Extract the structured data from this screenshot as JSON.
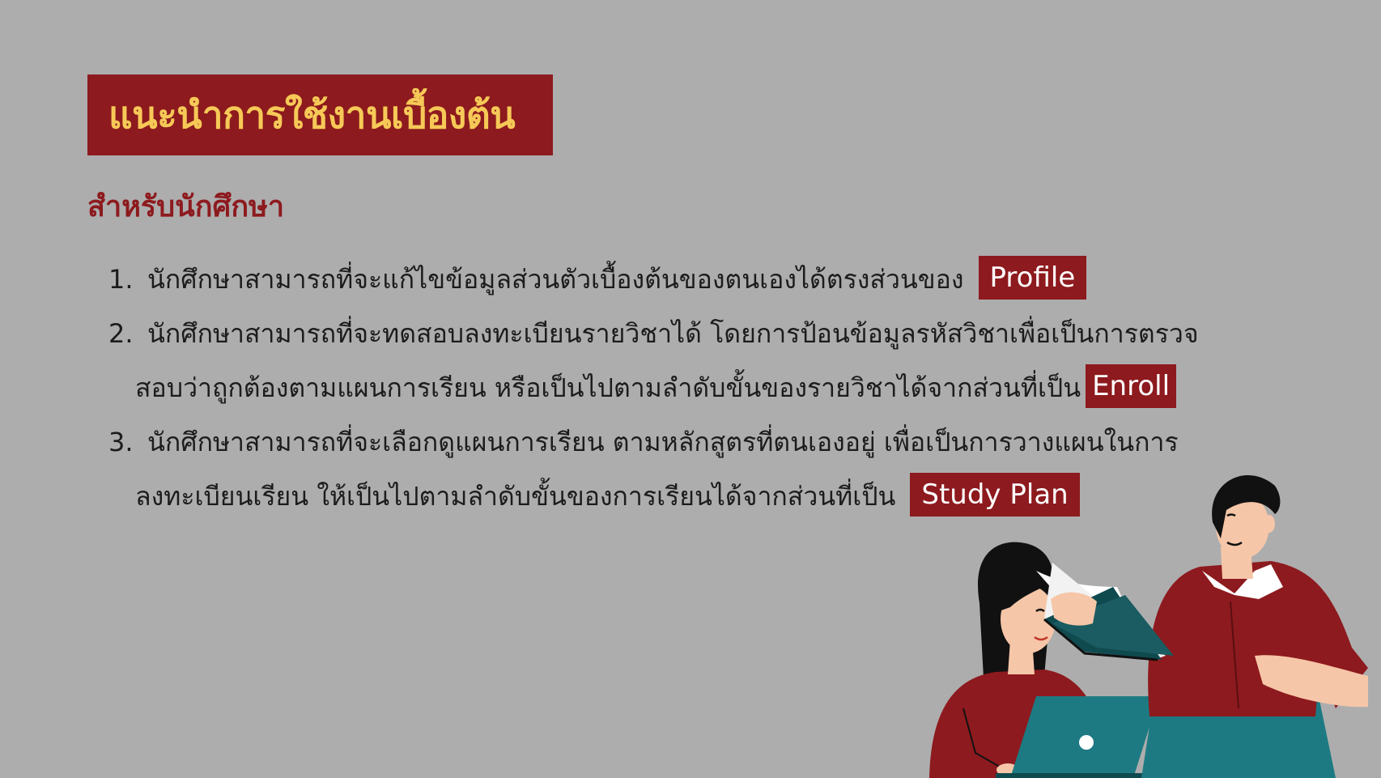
{
  "header": {
    "title": "แนะนำการใช้งานเบื้องต้น",
    "subtitle": "สำหรับนักศึกษา"
  },
  "items": [
    {
      "number": "1.",
      "lines": [
        "นักศึกษาสามารถที่จะแก้ไขข้อมูลส่วนตัวเบื้องต้นของตนเองได้ตรงส่วนของ"
      ],
      "tag": "Profile"
    },
    {
      "number": "2.",
      "lines": [
        "นักศึกษาสามารถที่จะทดสอบลงทะเบียนรายวิชาได้ โดยการป้อนข้อมูลรหัสวิชาเพื่อเป็นการตรวจ",
        "สอบว่าถูกต้องตามแผนการเรียน หรือเป็นไปตามลำดับขั้นของรายวิชาได้จากส่วนที่เป็น"
      ],
      "tag": "Enroll"
    },
    {
      "number": "3.",
      "lines": [
        "นักศึกษาสามารถที่จะเลือกดูแผนการเรียน ตามหลักสูตรที่ตนเองอยู่ เพื่อเป็นการวางแผนในการ",
        "ลงทะเบียนเรียน ให้เป็นไปตามลำดับขั้นของการเรียนได้จากส่วนที่เป็น"
      ],
      "tag": "Study Plan"
    }
  ],
  "colors": {
    "background": "#adadad",
    "brand_red": "#8d1a1e",
    "title_yellow": "#f6c957",
    "teal": "#1d7a82",
    "dark_teal": "#0f4a4f",
    "skin": "#f6c6a8"
  },
  "illustration": {
    "icon": "students-reading-illustration"
  }
}
